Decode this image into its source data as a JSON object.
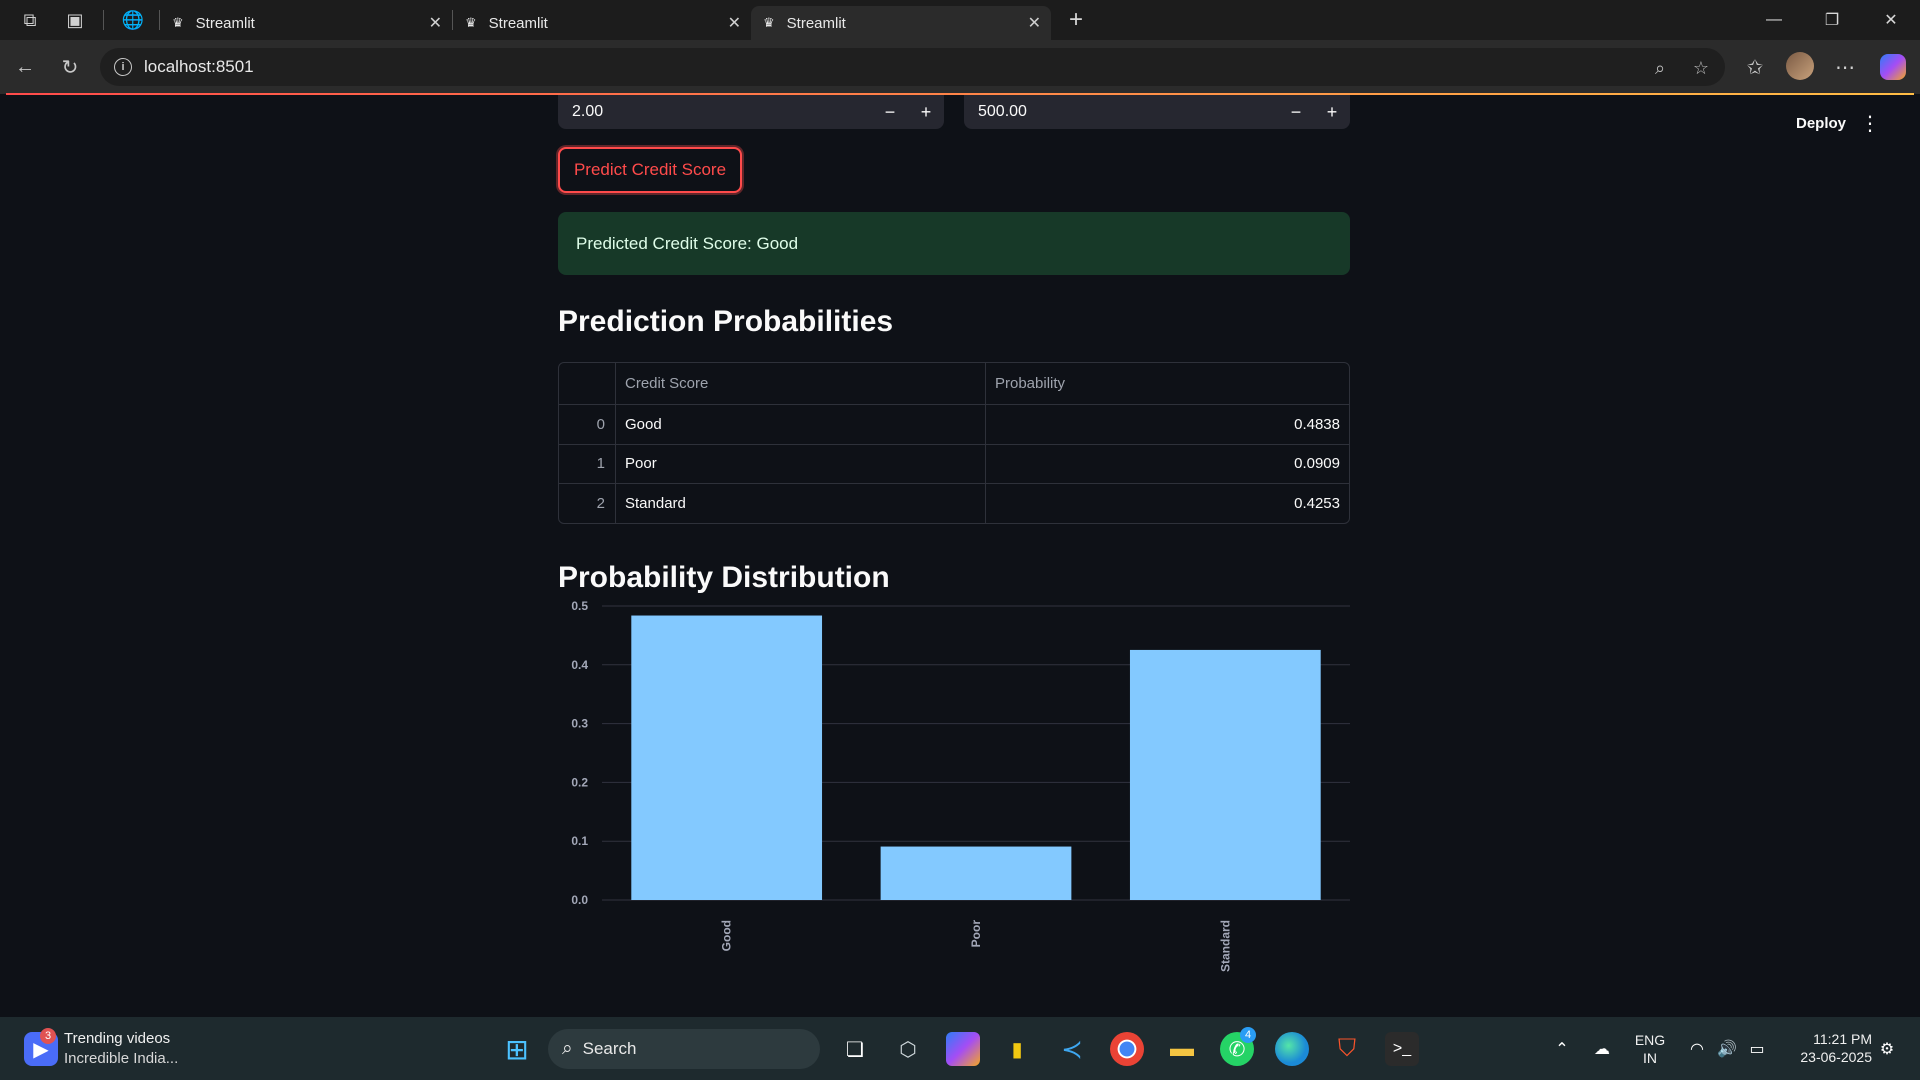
{
  "browser": {
    "tabs": [
      {
        "title": "Streamlit",
        "active": false
      },
      {
        "title": "Streamlit",
        "active": false
      },
      {
        "title": "Streamlit",
        "active": true
      }
    ],
    "url": "localhost:8501"
  },
  "app": {
    "deploy_label": "Deploy",
    "inputs": [
      {
        "value": "2.00"
      },
      {
        "value": "500.00"
      }
    ],
    "predict_button": "Predict Credit Score",
    "success_message": "Predicted Credit Score: Good",
    "table_heading": "Prediction Probabilities",
    "table": {
      "columns": [
        "Credit Score",
        "Probability"
      ],
      "rows": [
        {
          "index": "0",
          "score": "Good",
          "probability": "0.4838"
        },
        {
          "index": "1",
          "score": "Poor",
          "probability": "0.0909"
        },
        {
          "index": "2",
          "score": "Standard",
          "probability": "0.4253"
        }
      ]
    },
    "chart_heading": "Probability Distribution"
  },
  "chart_data": {
    "type": "bar",
    "categories": [
      "Good",
      "Poor",
      "Standard"
    ],
    "values": [
      0.4838,
      0.0909,
      0.4253
    ],
    "ylim": [
      0,
      0.5
    ],
    "yticks": [
      "0.0",
      "0.1",
      "0.2",
      "0.3",
      "0.4",
      "0.5"
    ],
    "bar_color": "#83c9ff",
    "grid": true
  },
  "taskbar": {
    "widget_title": "Trending videos",
    "widget_subtitle": "Incredible India...",
    "widget_badge": "3",
    "search_label": "Search",
    "whatsapp_badge": "4",
    "language_line1": "ENG",
    "language_line2": "IN",
    "time": "11:21 PM",
    "date": "23-06-2025"
  }
}
